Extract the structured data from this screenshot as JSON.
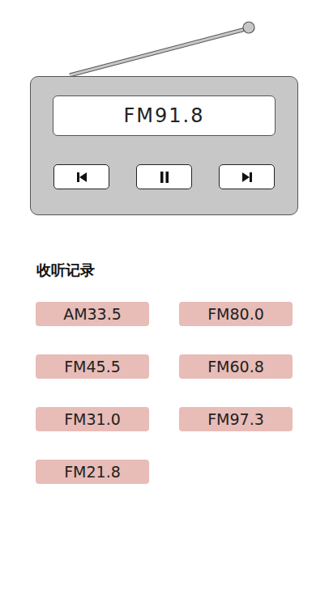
{
  "radio": {
    "display": "FM91.8"
  },
  "history": {
    "title": "收听记录",
    "items": [
      "AM33.5",
      "FM80.0",
      "FM45.5",
      "FM60.8",
      "FM31.0",
      "FM97.3",
      "FM21.8"
    ]
  }
}
